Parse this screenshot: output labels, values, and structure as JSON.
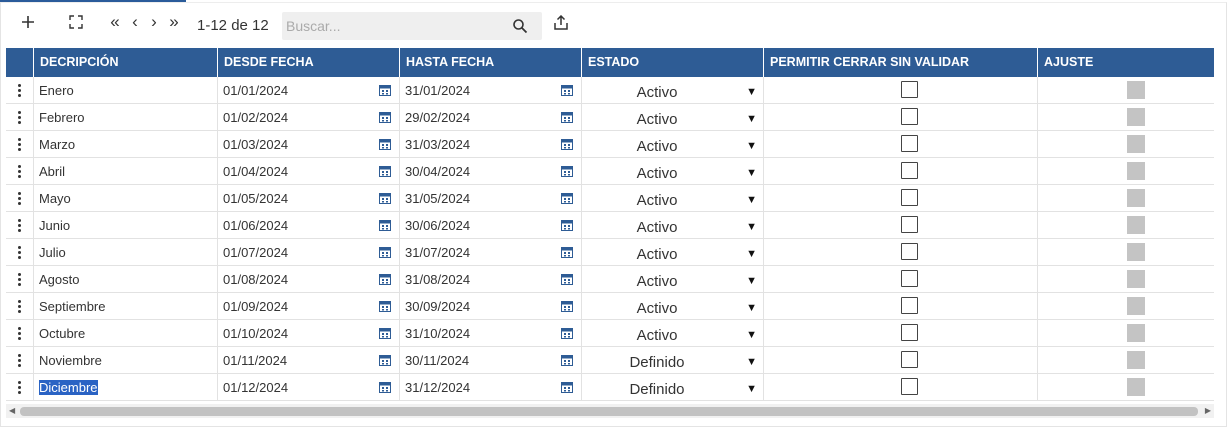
{
  "toolbar": {
    "add_icon": "plus-icon",
    "expand_icon": "expand-icon",
    "first_label": "«",
    "prev_label": "‹",
    "next_label": "›",
    "last_label": "»",
    "record_count": "1-12 de 12",
    "search_placeholder": "Buscar...",
    "search_icon": "search-icon",
    "export_icon": "export-icon"
  },
  "table": {
    "columns": [
      "DECRIPCIÓN",
      "DESDE FECHA",
      "HASTA FECHA",
      "ESTADO",
      "PERMITIR CERRAR SIN VALIDAR",
      "AJUSTE"
    ],
    "rows": [
      {
        "descripcion": "Enero",
        "desde": "01/01/2024",
        "hasta": "31/01/2024",
        "estado": "Activo",
        "permitir": false
      },
      {
        "descripcion": "Febrero",
        "desde": "01/02/2024",
        "hasta": "29/02/2024",
        "estado": "Activo",
        "permitir": false
      },
      {
        "descripcion": "Marzo",
        "desde": "01/03/2024",
        "hasta": "31/03/2024",
        "estado": "Activo",
        "permitir": false
      },
      {
        "descripcion": "Abril",
        "desde": "01/04/2024",
        "hasta": "30/04/2024",
        "estado": "Activo",
        "permitir": false
      },
      {
        "descripcion": "Mayo",
        "desde": "01/05/2024",
        "hasta": "31/05/2024",
        "estado": "Activo",
        "permitir": false
      },
      {
        "descripcion": "Junio",
        "desde": "01/06/2024",
        "hasta": "30/06/2024",
        "estado": "Activo",
        "permitir": false
      },
      {
        "descripcion": "Julio",
        "desde": "01/07/2024",
        "hasta": "31/07/2024",
        "estado": "Activo",
        "permitir": false
      },
      {
        "descripcion": "Agosto",
        "desde": "01/08/2024",
        "hasta": "31/08/2024",
        "estado": "Activo",
        "permitir": false
      },
      {
        "descripcion": "Septiembre",
        "desde": "01/09/2024",
        "hasta": "30/09/2024",
        "estado": "Activo",
        "permitir": false
      },
      {
        "descripcion": "Octubre",
        "desde": "01/10/2024",
        "hasta": "31/10/2024",
        "estado": "Activo",
        "permitir": false
      },
      {
        "descripcion": "Noviembre",
        "desde": "01/11/2024",
        "hasta": "30/11/2024",
        "estado": "Definido",
        "permitir": false
      },
      {
        "descripcion": "Diciembre",
        "desde": "01/12/2024",
        "hasta": "31/12/2024",
        "estado": "Definido",
        "permitir": false
      }
    ],
    "selected_text_row": 11,
    "header_color": "#2e5c95",
    "calendar_icon": "calendar-icon",
    "row_menu_icon": "kebab-menu-icon",
    "dropdown_icon": "caret-down-icon",
    "selection_color": "#2a63c4"
  }
}
